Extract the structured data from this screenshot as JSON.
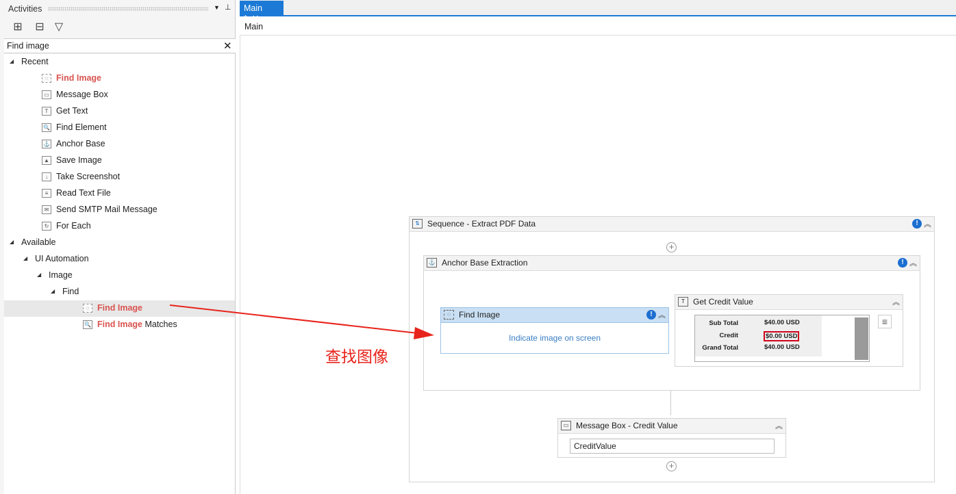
{
  "activities": {
    "title": "Activities",
    "search_value": "Find image",
    "toolbar": [
      {
        "icon": "expand-all-icon"
      },
      {
        "icon": "collapse-all-icon"
      },
      {
        "icon": "filter-icon"
      }
    ],
    "tree": [
      {
        "label": "Recent",
        "type": "group",
        "level": 0
      },
      {
        "label": "Find Image",
        "hl": "Find Image",
        "rest": "",
        "level": 1,
        "icon": "find-image-icon"
      },
      {
        "label": "Message Box",
        "level": 1,
        "icon": "message-box-icon",
        "g": "▭"
      },
      {
        "label": "Get Text",
        "level": 1,
        "icon": "get-text-icon",
        "g": "T"
      },
      {
        "label": "Find Element",
        "level": 1,
        "icon": "magnifier-icon",
        "g": "🔍"
      },
      {
        "label": "Anchor Base",
        "level": 1,
        "icon": "anchor-base-icon",
        "g": "⚓"
      },
      {
        "label": "Save Image",
        "level": 1,
        "icon": "save-image-icon",
        "g": "▲"
      },
      {
        "label": "Take Screenshot",
        "level": 1,
        "icon": "take-screenshot-icon",
        "g": "↓"
      },
      {
        "label": "Read Text File",
        "level": 1,
        "icon": "read-text-file-icon",
        "g": "≡"
      },
      {
        "label": "Send SMTP Mail Message",
        "level": 1,
        "icon": "mail-icon",
        "g": "✉"
      },
      {
        "label": "For Each",
        "level": 1,
        "icon": "for-each-icon",
        "g": "↻"
      },
      {
        "label": "Available",
        "type": "group",
        "level": 0
      },
      {
        "label": "UI Automation",
        "type": "group",
        "level": 1
      },
      {
        "label": "Image",
        "type": "group",
        "level": 2
      },
      {
        "label": "Find",
        "type": "group",
        "level": 3
      },
      {
        "label": "Find Image",
        "hl": "Find Image",
        "rest": "",
        "level": 4,
        "icon": "find-image-icon",
        "selected": true
      },
      {
        "label": "Find Image Matches",
        "hl": "Find Image",
        "rest": " Matches",
        "level": 4,
        "icon": "magnifier-icon",
        "g": "🔍"
      }
    ]
  },
  "tab": {
    "label": "Main *"
  },
  "breadcrumb": "Main",
  "workflow": {
    "sequence": "Sequence - Extract PDF Data",
    "anchor": "Anchor Base Extraction",
    "find_image": {
      "title": "Find Image",
      "hint": "Indicate image on screen"
    },
    "get_credit": {
      "title": "Get Credit Value",
      "rows": [
        [
          "Sub Total",
          "$40.00 USD"
        ],
        [
          "Credit",
          "$0.00 USD"
        ],
        [
          "Grand Total",
          "$40.00 USD"
        ]
      ]
    },
    "message_box": {
      "title": "Message Box - Credit Value",
      "value": "CreditValue"
    }
  },
  "annotation": {
    "text": "查找图像",
    "color": "#e8231b"
  }
}
